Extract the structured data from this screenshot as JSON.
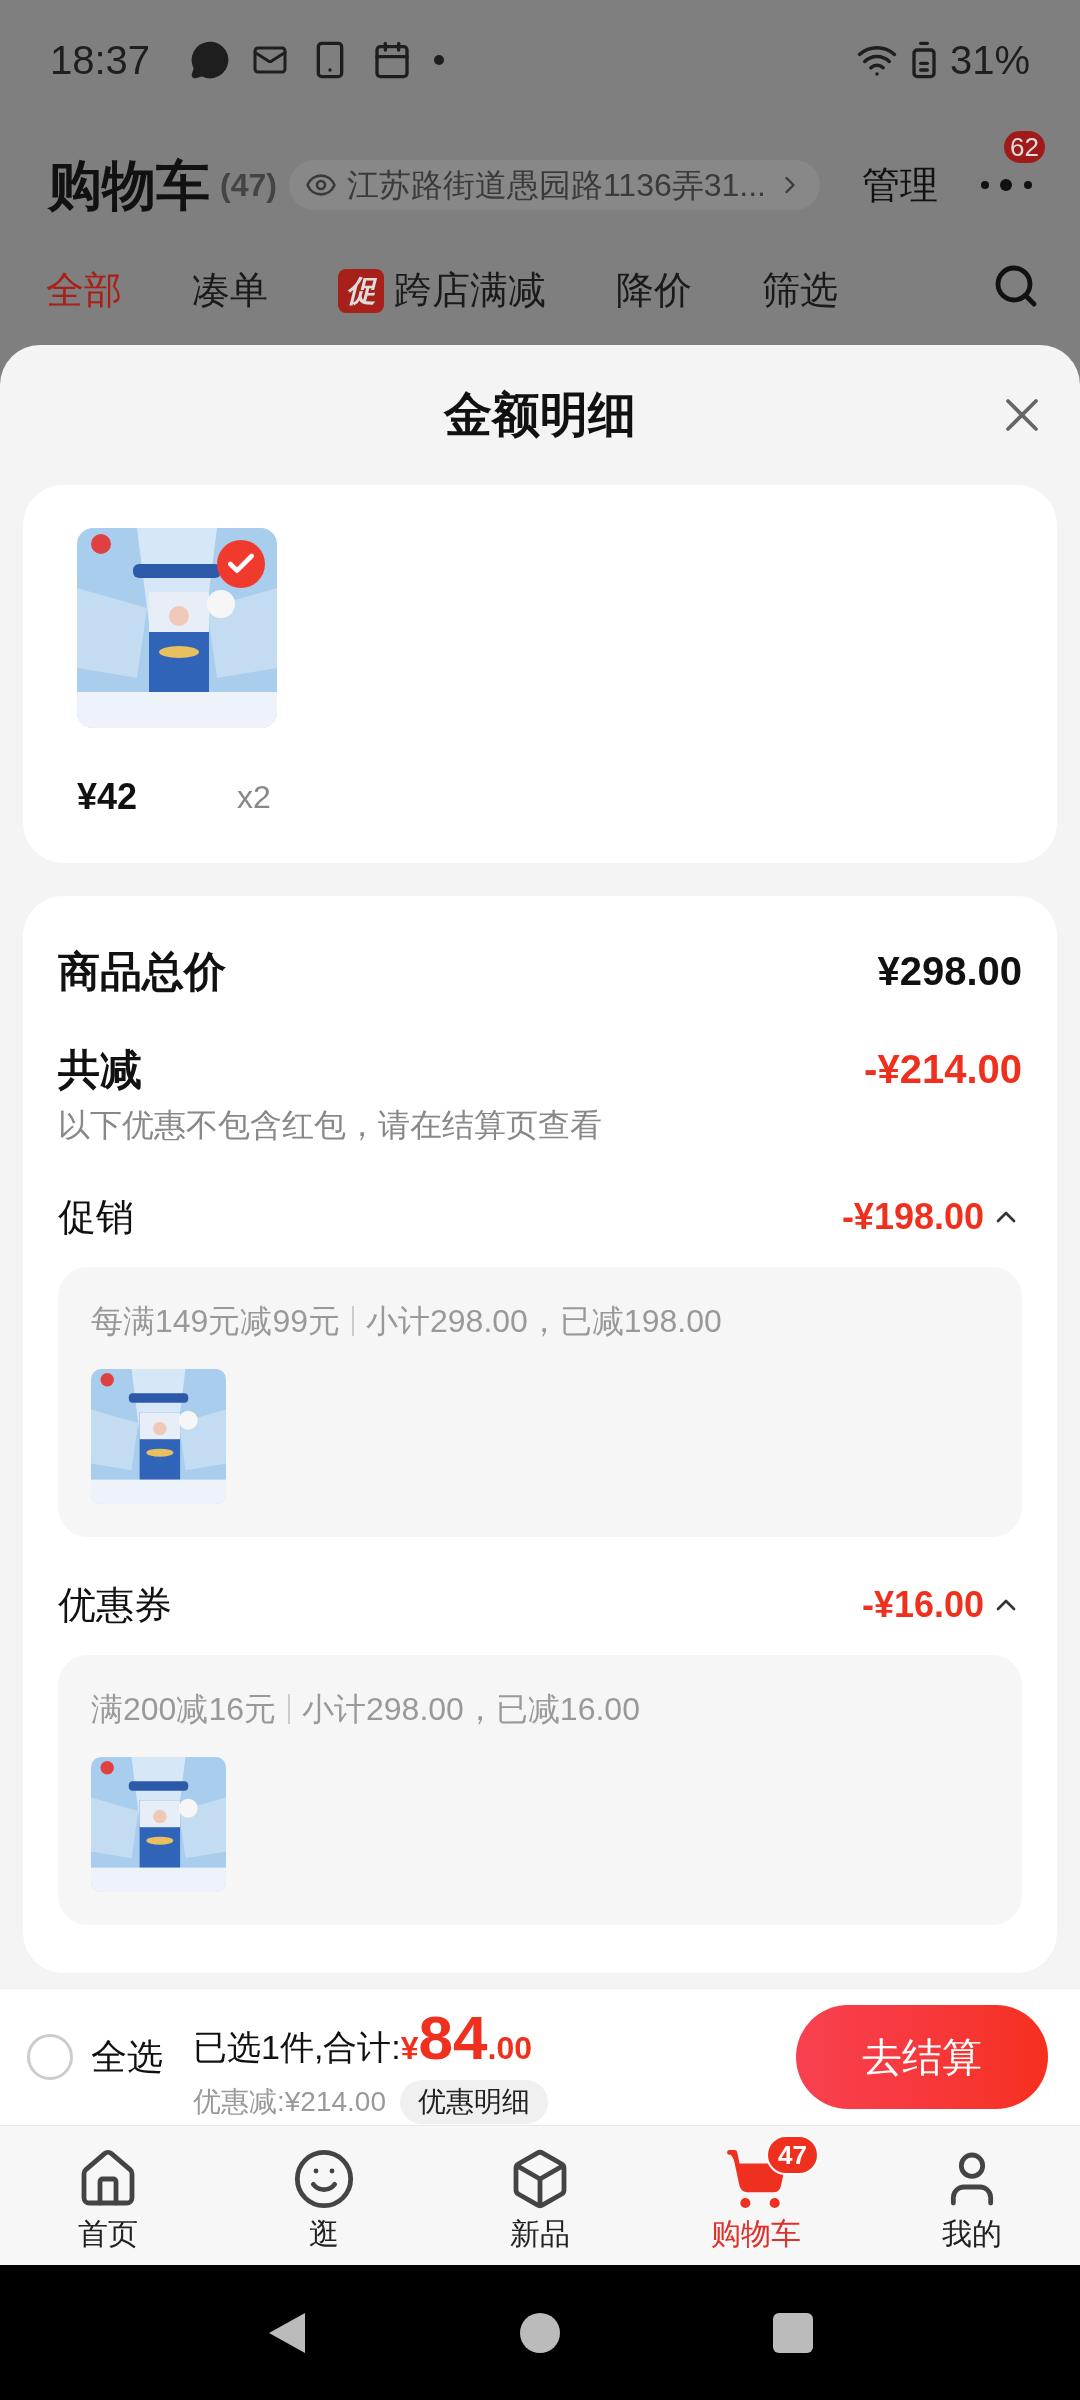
{
  "status_bar": {
    "time": "18:37",
    "battery": "31%"
  },
  "header": {
    "title": "购物车",
    "count": "(47)",
    "address": "江苏路街道愚园路1136弄31...",
    "manage": "管理",
    "message_badge": "62"
  },
  "filter_tabs": [
    {
      "label": "全部",
      "selected": true
    },
    {
      "label": "凑单",
      "selected": false
    },
    {
      "label": "跨店满减",
      "tag": "促",
      "selected": false
    },
    {
      "label": "降价",
      "selected": false
    },
    {
      "label": "筛选",
      "selected": false
    }
  ],
  "sheet": {
    "title": "金额明细",
    "product": {
      "price": "¥42",
      "quantity": "x2",
      "checked": true
    },
    "summary": {
      "total_label": "商品总价",
      "total_value": "¥298.00",
      "reduction_label": "共减",
      "reduction_value": "-¥214.00",
      "note": "以下优惠不包含红包，请在结算页查看",
      "sections": [
        {
          "label": "促销",
          "amount": "-¥198.00",
          "expanded": true,
          "rule": "每满149元减99元",
          "detail": "小计298.00，已减198.00"
        },
        {
          "label": "优惠券",
          "amount": "-¥16.00",
          "expanded": true,
          "rule": "满200减16元",
          "detail": "小计298.00，已减16.00"
        }
      ]
    }
  },
  "checkout_bar": {
    "select_all": {
      "label": "全选",
      "checked": false
    },
    "selected_text": "已选1件,合计:",
    "currency": "¥",
    "amount_integer": "84",
    "amount_decimal": ".00",
    "discount": "优惠减:¥214.00",
    "detail_button": "优惠明细",
    "checkout_button": "去结算"
  },
  "bottom_nav": [
    {
      "label": "首页",
      "selected": false
    },
    {
      "label": "逛",
      "selected": false
    },
    {
      "label": "新品",
      "selected": false
    },
    {
      "label": "购物车",
      "selected": true,
      "badge": "47"
    },
    {
      "label": "我的",
      "selected": false
    }
  ]
}
